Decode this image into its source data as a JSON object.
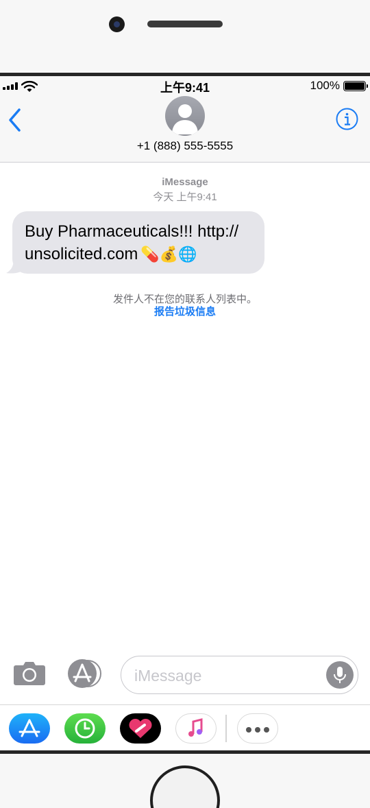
{
  "status_bar": {
    "time": "上午9:41",
    "battery": "100%",
    "icons": [
      "signal-icon",
      "wifi-icon",
      "battery-icon"
    ]
  },
  "header": {
    "contact": "+1 (888) 555-5555",
    "icons": [
      "back-chevron-icon",
      "contact-avatar-icon",
      "info-icon"
    ]
  },
  "conversation": {
    "service": "iMessage",
    "timestamp": "今天 上午9:41",
    "message": {
      "line1": "Buy Pharmaceuticals!!! http://",
      "line2": "unsolicited.com",
      "emojis": "💊💰🌐"
    },
    "notice": "发件人不在您的联系人列表中。",
    "report_link": "报告垃圾信息"
  },
  "compose": {
    "placeholder": "iMessage",
    "icons": [
      "camera-icon",
      "app-store-icon",
      "microphone-icon"
    ]
  },
  "app_drawer": {
    "apps": [
      "app-store-icon",
      "digital-touch-icon",
      "heart-stickers-icon",
      "music-icon",
      "more-icon"
    ]
  },
  "colors": {
    "accent": "#1a7cf4",
    "bubble_received": "#e5e5ea",
    "secondary_text": "#8e8e93"
  }
}
